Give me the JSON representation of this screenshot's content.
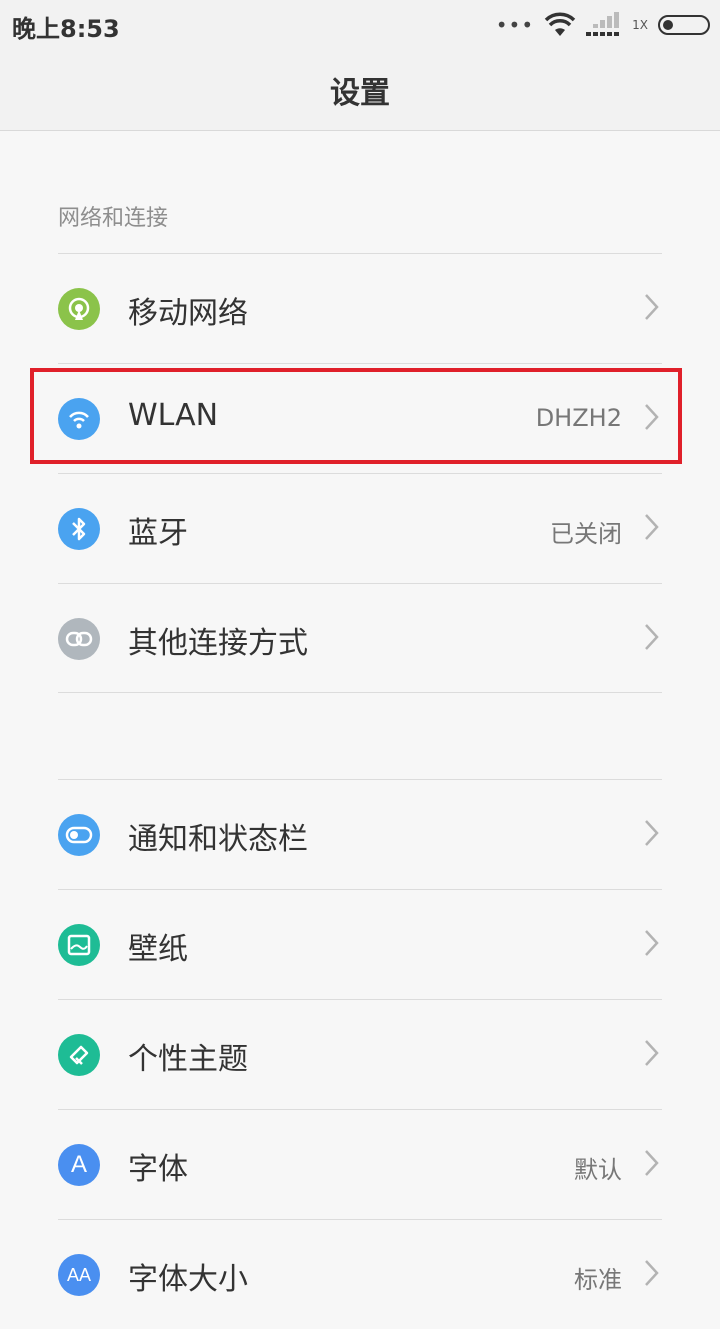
{
  "status": {
    "time": "晚上8:53",
    "dots": "•••",
    "network_label": "1X"
  },
  "header": {
    "title": "设置"
  },
  "sections": [
    {
      "header": "网络和连接",
      "items": [
        {
          "label": "移动网络",
          "value": "",
          "icon": "mobile-network-icon",
          "color": "#8bc34a"
        },
        {
          "label": "WLAN",
          "value": "DHZH2",
          "icon": "wifi-icon",
          "color": "#4aa3f0"
        },
        {
          "label": "蓝牙",
          "value": "已关闭",
          "icon": "bluetooth-icon",
          "color": "#4aa3f0"
        },
        {
          "label": "其他连接方式",
          "value": "",
          "icon": "link-icon",
          "color": "#b0b7bd"
        }
      ]
    },
    {
      "header": "",
      "items": [
        {
          "label": "通知和状态栏",
          "value": "",
          "icon": "toggle-icon",
          "color": "#4aa3f0"
        },
        {
          "label": "壁纸",
          "value": "",
          "icon": "wallpaper-icon",
          "color": "#1ebc95"
        },
        {
          "label": "个性主题",
          "value": "",
          "icon": "theme-brush-icon",
          "color": "#1ebc95"
        },
        {
          "label": "字体",
          "value": "默认",
          "icon": "font-icon",
          "color": "#4a8ff0"
        },
        {
          "label": "字体大小",
          "value": "标准",
          "icon": "font-size-icon",
          "color": "#4a8ff0"
        }
      ]
    }
  ]
}
